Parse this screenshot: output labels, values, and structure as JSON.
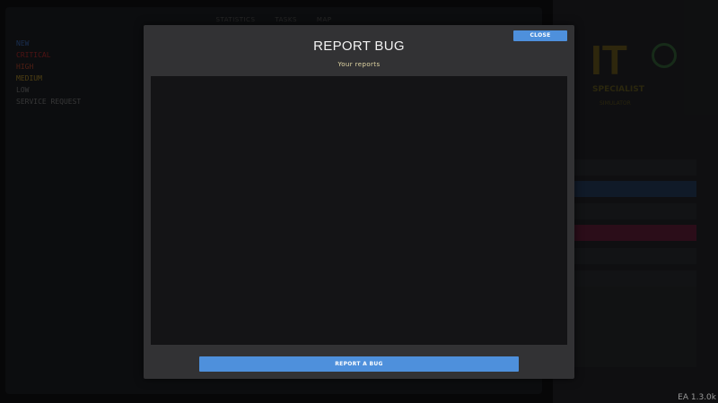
{
  "background": {
    "tabs": [
      "STATISTICS",
      "TASKS",
      "MAP"
    ],
    "priorities": [
      {
        "label": "NEW",
        "color": "#2f5fb0"
      },
      {
        "label": "CRITICAL",
        "color": "#b02020"
      },
      {
        "label": "HIGH",
        "color": "#b03a20"
      },
      {
        "label": "MEDIUM",
        "color": "#b08a20"
      },
      {
        "label": "LOW",
        "color": "#777777"
      },
      {
        "label": "SERVICE REQUEST",
        "color": "#777777"
      }
    ],
    "logo": {
      "main": "IT",
      "sub1": "SPECIALIST",
      "sub2": "SIMULATOR"
    }
  },
  "modal": {
    "close_label": "CLOSE",
    "title": "REPORT BUG",
    "subtitle": "Your reports",
    "report_button_label": "REPORT A BUG"
  },
  "version": "EA 1.3.0k",
  "colors": {
    "accent": "#4e90dc",
    "subtitle": "#e4d9a6"
  }
}
